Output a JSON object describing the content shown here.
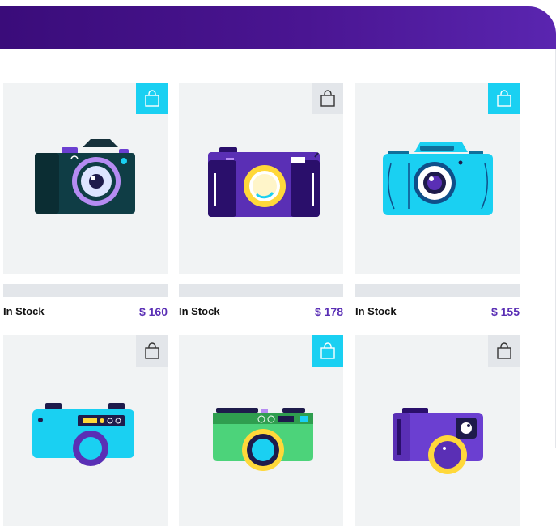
{
  "colors": {
    "banner": "#3a0c7a",
    "price": "#5a2fb5",
    "bag_active": "#1ad0f2",
    "bag_idle": "#e3e6ea"
  },
  "products": [
    {
      "stock": "In Stock",
      "price": "$ 160",
      "bag_icon": "shopping-bag-icon",
      "bag_active": true
    },
    {
      "stock": "In Stock",
      "price": "$ 178",
      "bag_icon": "shopping-bag-icon",
      "bag_active": false
    },
    {
      "stock": "In Stock",
      "price": "$ 155",
      "bag_icon": "shopping-bag-icon",
      "bag_active": true
    },
    {
      "bag_icon": "shopping-bag-icon",
      "bag_active": false
    },
    {
      "bag_icon": "shopping-bag-icon",
      "bag_active": true
    },
    {
      "bag_icon": "shopping-bag-icon",
      "bag_active": false
    }
  ]
}
